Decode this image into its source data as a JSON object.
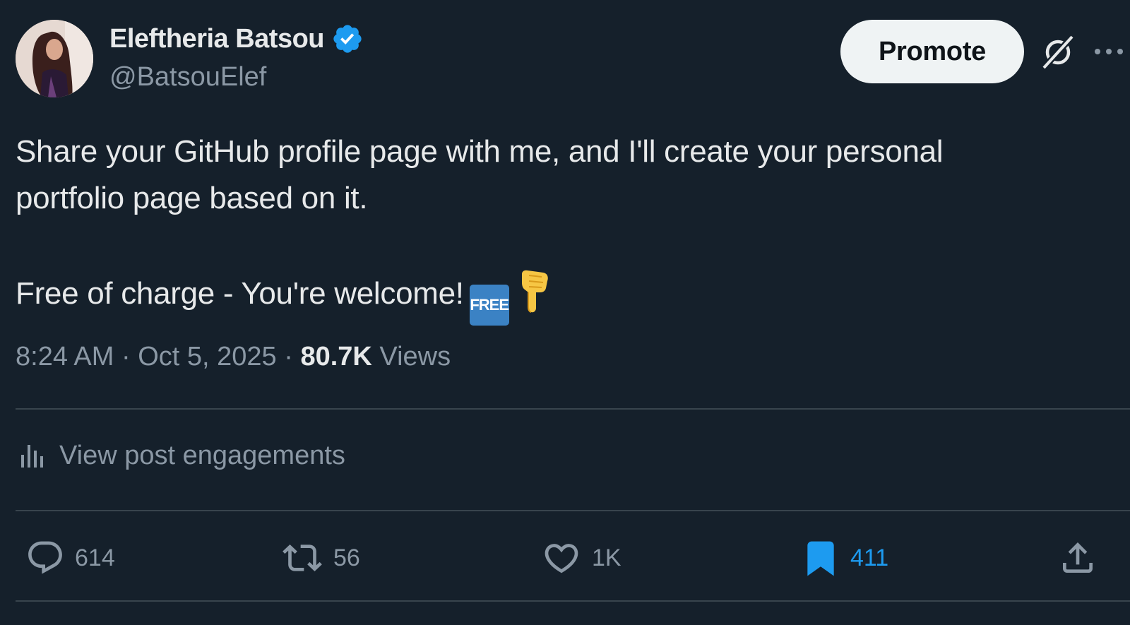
{
  "author": {
    "name": "Eleftheria Batsou",
    "handle": "@BatsouElef",
    "verified": true,
    "verified_color": "#1d9bf0"
  },
  "header": {
    "promote_label": "Promote",
    "grok_icon": "grok-icon",
    "more_icon": "more-icon"
  },
  "post": {
    "line1": "Share your GitHub profile page with me, and I'll create your personal",
    "line2": "portfolio page based on it.",
    "line3": "Free of charge - You're welcome!",
    "free_emoji_text": "FREE",
    "point_emoji": "backhand-index-pointing-down"
  },
  "meta": {
    "time": "8:24 AM",
    "separator": "·",
    "date": "Oct 5, 2025",
    "views_count": "80.7K",
    "views_label": "Views"
  },
  "engagements": {
    "label": "View post engagements",
    "icon": "analytics-icon"
  },
  "actions": {
    "replies": "614",
    "reposts": "56",
    "likes": "1K",
    "bookmarks": "411",
    "bookmarked": true,
    "accent_color": "#1d9bf0"
  },
  "colors": {
    "background": "#15202b",
    "primary_text": "#e7e9ea",
    "secondary_text": "#8b98a5",
    "divider": "#38444d"
  }
}
